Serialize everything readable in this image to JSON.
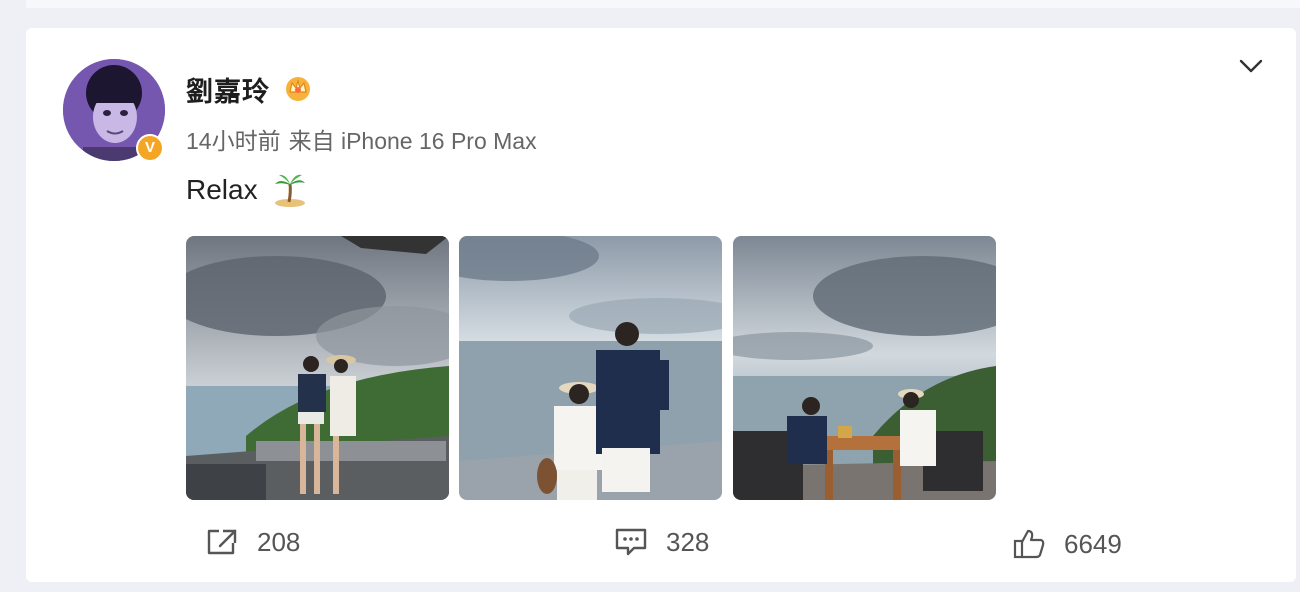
{
  "post": {
    "author": "劉嘉玲",
    "time": "14小时前",
    "source": "来自 iPhone 16 Pro Max",
    "text": "Relax",
    "verified_badge": "V",
    "icons": {
      "crown": "crown-icon",
      "palm": "palm-tree-emoji",
      "menu": "chevron-down-icon"
    },
    "images": [
      {
        "name": "photo-1"
      },
      {
        "name": "photo-2"
      },
      {
        "name": "photo-3"
      }
    ]
  },
  "actions": {
    "repost_count": "208",
    "comment_count": "328",
    "like_count": "6649"
  },
  "colors": {
    "background": "#eef0f5",
    "card": "#ffffff",
    "badge": "#f5a524",
    "text": "#1e1e1e",
    "muted": "#666666"
  }
}
